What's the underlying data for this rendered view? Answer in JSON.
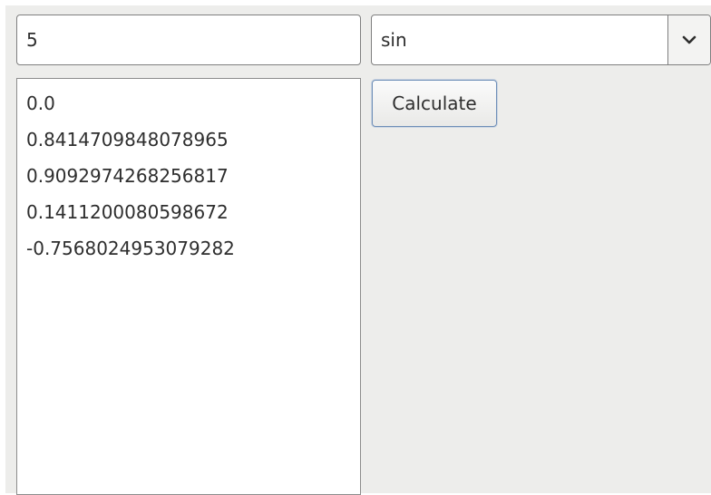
{
  "inputs": {
    "number_value": "5"
  },
  "function_select": {
    "selected": "sin",
    "icon": "chevron-down-icon"
  },
  "actions": {
    "calculate_label": "Calculate"
  },
  "results": {
    "items": [
      "0.0",
      "0.8414709848078965",
      "0.9092974268256817",
      "0.1411200080598672",
      "-0.7568024953079282"
    ]
  },
  "colors": {
    "window_background": "#ededeb",
    "field_background": "#ffffff",
    "border": "#7f7f7f",
    "button_focus_border": "#6f8fb8",
    "text": "#2e2e2e"
  }
}
